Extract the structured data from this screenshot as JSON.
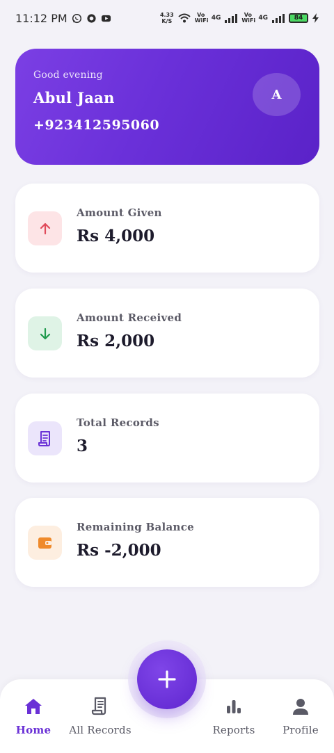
{
  "status_bar": {
    "time": "11:12 PM",
    "net_speed_value": "4.33",
    "net_speed_unit": "K/S",
    "sim1_label": "Vo WiFi",
    "sim1_gen": "4G",
    "sim2_label": "Vo WiFi",
    "sim2_gen": "4G",
    "battery": "84"
  },
  "header": {
    "greeting": "Good evening",
    "name": "Abul Jaan",
    "phone": "+923412595060",
    "avatar_initial": "A"
  },
  "stats": [
    {
      "label": "Amount Given",
      "value": "Rs 4,000",
      "icon": "arrow-up-icon",
      "icon_bg": "#fde4e6",
      "icon_color": "#e04a5a"
    },
    {
      "label": "Amount Received",
      "value": "Rs 2,000",
      "icon": "arrow-down-icon",
      "icon_bg": "#dff3e6",
      "icon_color": "#1f9a4d"
    },
    {
      "label": "Total Records",
      "value": "3",
      "icon": "receipt-icon",
      "icon_bg": "#ebe5fb",
      "icon_color": "#6a31d6"
    },
    {
      "label": "Remaining Balance",
      "value": "Rs -2,000",
      "icon": "wallet-icon",
      "icon_bg": "#fdeee0",
      "icon_color": "#ef8a2b"
    }
  ],
  "nav": {
    "items": [
      {
        "label": "Home",
        "icon": "home-icon",
        "active": true
      },
      {
        "label": "All Records",
        "icon": "receipt-icon",
        "active": false
      },
      {
        "label": "Reports",
        "icon": "bar-chart-icon",
        "active": false
      },
      {
        "label": "Profile",
        "icon": "person-icon",
        "active": false
      }
    ],
    "fab_icon": "plus-icon"
  },
  "colors": {
    "accent": "#6a31d6",
    "background": "#f3f2f8"
  }
}
